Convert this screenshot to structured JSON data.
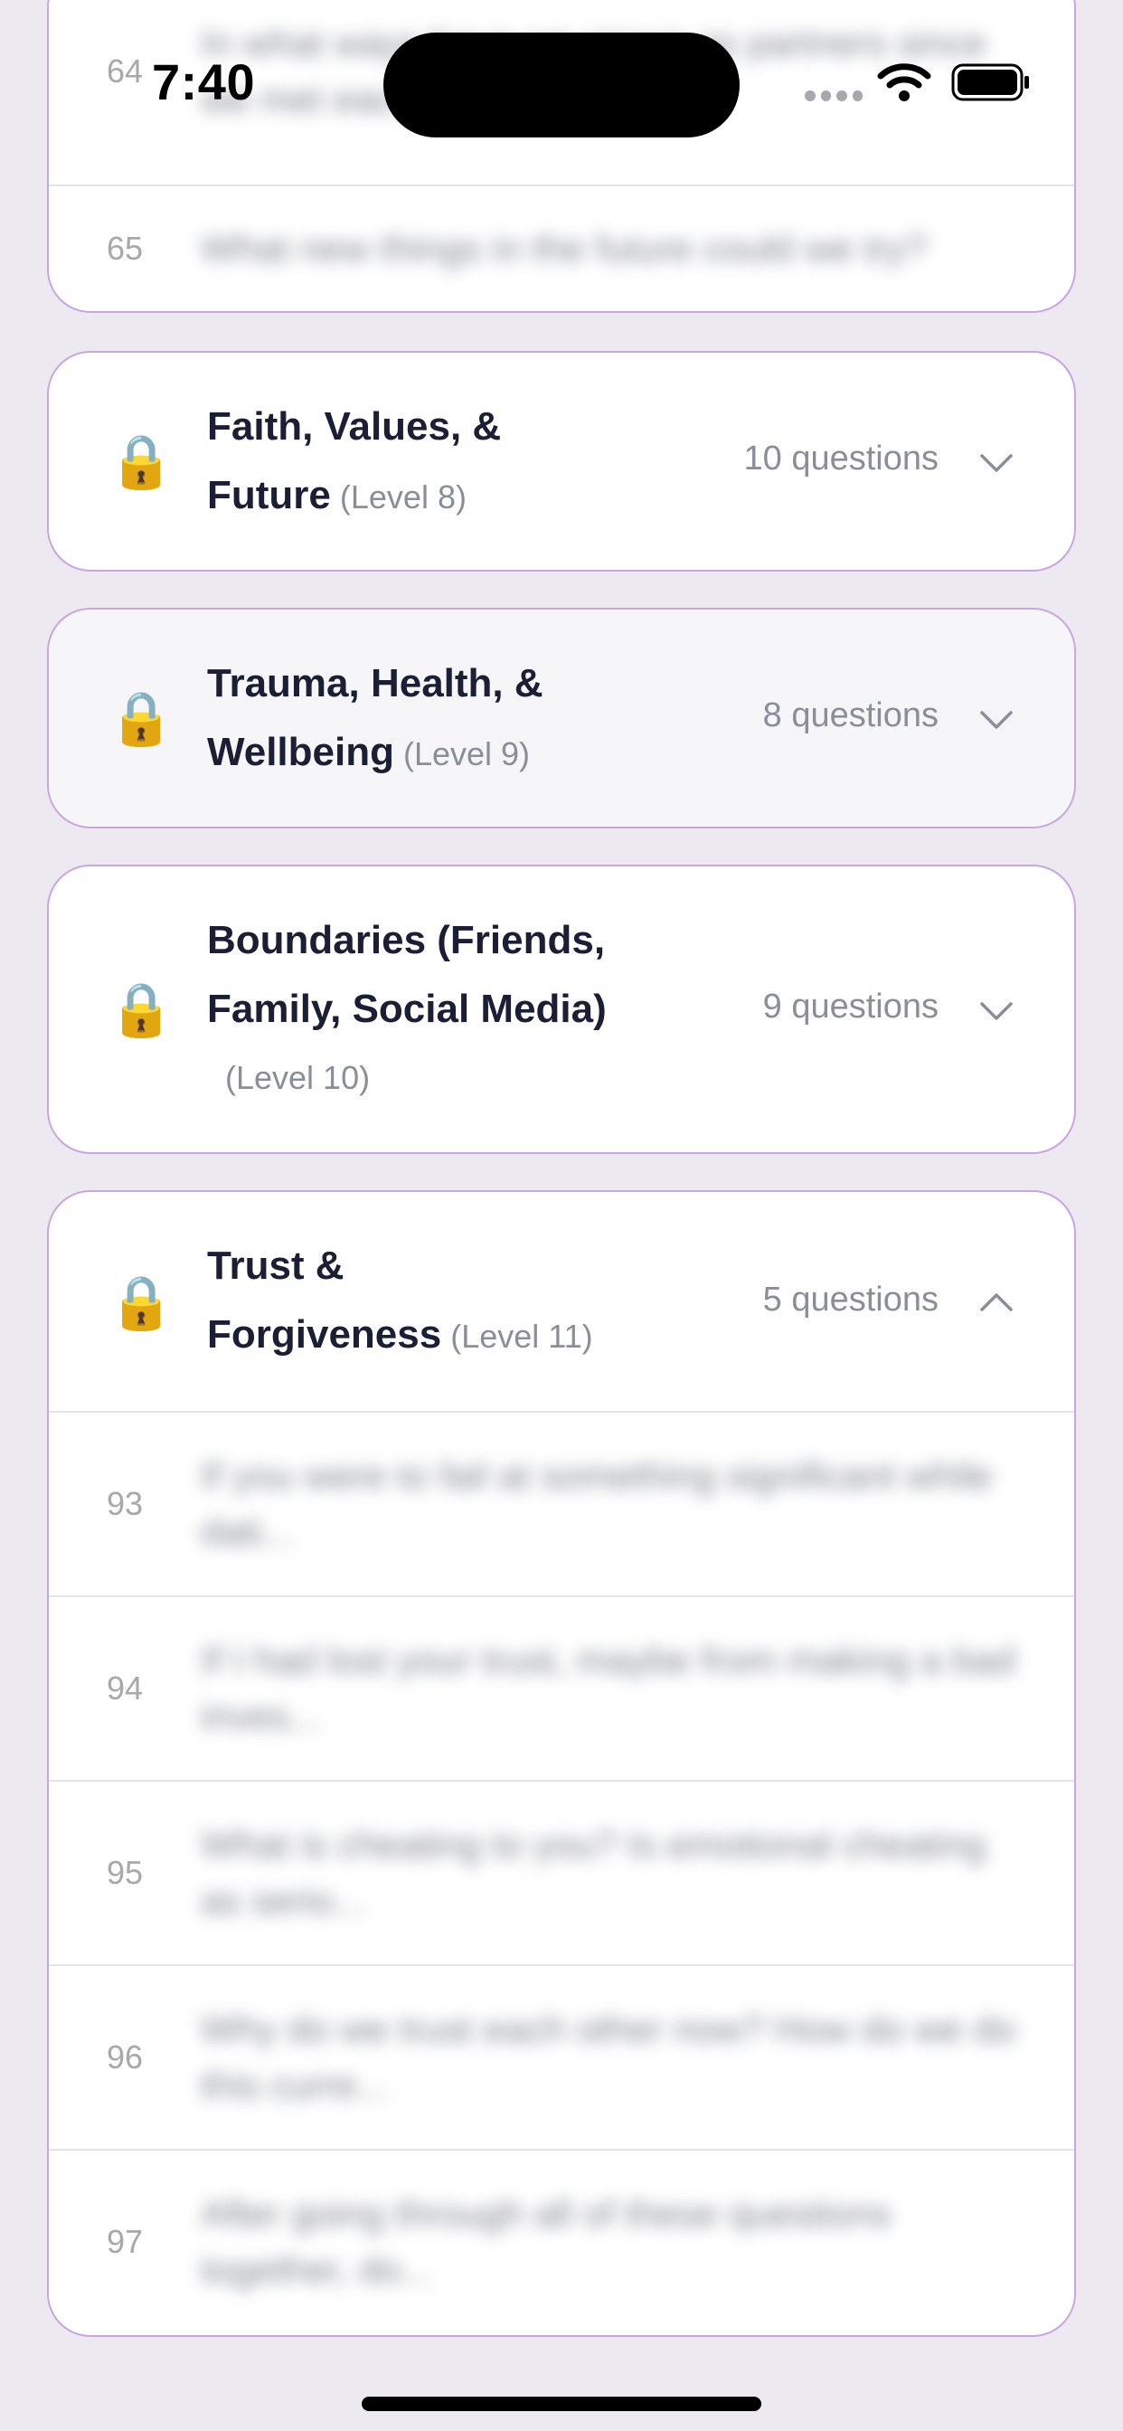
{
  "status_bar": {
    "time": "7:40"
  },
  "top_card": {
    "rows": [
      {
        "number": "64",
        "text": "In what ways have we grown as partners since we met each other..."
      },
      {
        "number": "65",
        "text": "What new things in the future could we try?"
      }
    ]
  },
  "categories": [
    {
      "lock_icon": "🔒",
      "title": "Faith, Values, & Future",
      "level": "(Level 8)",
      "count": "10 questions",
      "chevron": "down"
    },
    {
      "lock_icon": "🔒",
      "title": "Trauma, Health, & Wellbeing",
      "level": "(Level 9)",
      "count": "8 questions",
      "chevron": "down"
    },
    {
      "lock_icon": "🔒",
      "title": "Boundaries (Friends, Family, Social Media)",
      "level": "(Level 10)",
      "count": "9 questions",
      "chevron": "down"
    },
    {
      "lock_icon": "🔒",
      "title": "Trust & Forgiveness",
      "level": "(Level 11)",
      "count": "5 questions",
      "chevron": "up",
      "questions": [
        {
          "number": "93",
          "text": "If you were to fail at something significant while dati..."
        },
        {
          "number": "94",
          "text": "If I had lost your trust, maybe from making a bad inves..."
        },
        {
          "number": "95",
          "text": "What is cheating to you? Is emotional cheating as serio..."
        },
        {
          "number": "96",
          "text": "Why do we trust each other now? How do we do this curre..."
        },
        {
          "number": "97",
          "text": "After going through all of these questions together, do..."
        }
      ]
    }
  ],
  "colors": {
    "background": "#ECE9F0",
    "card_border": "#C8A7E0",
    "title_text": "#1B1F35",
    "muted_text": "#8A8E99"
  }
}
